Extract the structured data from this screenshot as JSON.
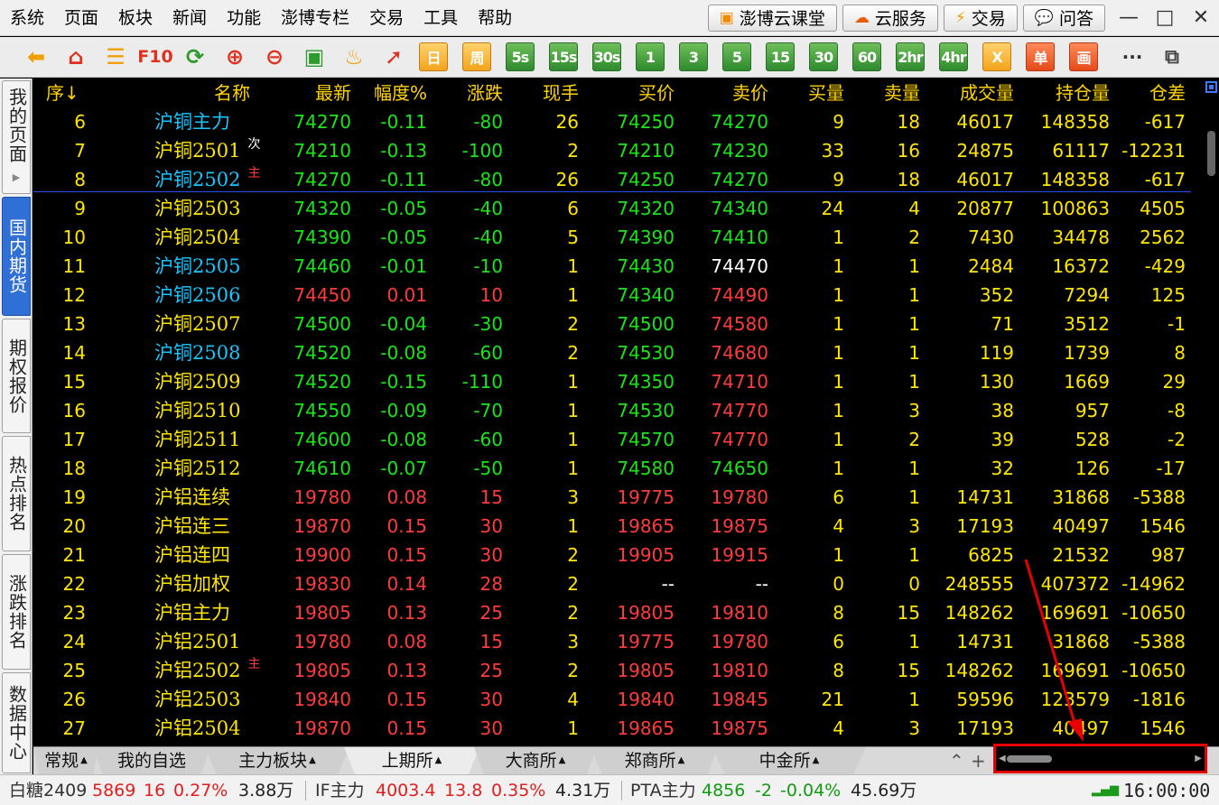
{
  "menu": [
    "系统",
    "页面",
    "板块",
    "新闻",
    "功能",
    "澎博专栏",
    "交易",
    "工具",
    "帮助"
  ],
  "top_buttons": [
    {
      "label": "澎博云课堂",
      "icon": "classroom-icon"
    },
    {
      "label": "云服务",
      "icon": "cloud-icon"
    },
    {
      "label": "交易",
      "icon": "lightning-icon"
    },
    {
      "label": "问答",
      "icon": "chat-icon"
    }
  ],
  "toolbar": {
    "f10": "F10",
    "periods": [
      "日",
      "周",
      "5s",
      "15s",
      "30s",
      "1",
      "3",
      "5",
      "15",
      "30",
      "60",
      "2hr",
      "4hr",
      "X",
      "单",
      "画"
    ],
    "more": "···"
  },
  "sidebar": [
    {
      "label": "我的页面",
      "active": false,
      "arrow": true
    },
    {
      "label": "国内期货",
      "active": true,
      "arrow": false
    },
    {
      "label": "期权报价",
      "active": false,
      "arrow": false
    },
    {
      "label": "热点排名",
      "active": false,
      "arrow": false
    },
    {
      "label": "涨跌排名",
      "active": false,
      "arrow": false
    },
    {
      "label": "数据中心",
      "active": false,
      "arrow": false
    }
  ],
  "columns": [
    "序↓",
    "名称",
    "最新",
    "幅度%",
    "涨跌",
    "现手",
    "买价",
    "卖价",
    "买量",
    "卖量",
    "成交量",
    "持仓量",
    "仓差"
  ],
  "rows": [
    {
      "seq": "6",
      "name": "沪铜主力",
      "tag": "",
      "last": "74270",
      "pct": "-0.11",
      "chg": "-80",
      "hand": "26",
      "bid": "74250",
      "ask": "74270",
      "bidv": "9",
      "askv": "18",
      "vol": "46017",
      "oi": "148358",
      "diff": "-617",
      "nc": "cyan",
      "pc": "green",
      "bc": "green",
      "ac": "green"
    },
    {
      "seq": "7",
      "name": "沪铜2501",
      "tag": "次",
      "last": "74210",
      "pct": "-0.13",
      "chg": "-100",
      "hand": "2",
      "bid": "74210",
      "ask": "74230",
      "bidv": "33",
      "askv": "16",
      "vol": "24875",
      "oi": "61117",
      "diff": "-12231",
      "nc": "yellow",
      "pc": "green",
      "bc": "green",
      "ac": "green"
    },
    {
      "seq": "8",
      "name": "沪铜2502",
      "tag": "主",
      "last": "74270",
      "pct": "-0.11",
      "chg": "-80",
      "hand": "26",
      "bid": "74250",
      "ask": "74270",
      "bidv": "9",
      "askv": "18",
      "vol": "46017",
      "oi": "148358",
      "diff": "-617",
      "nc": "cyan",
      "pc": "green",
      "bc": "green",
      "ac": "green"
    },
    {
      "seq": "9",
      "name": "沪铜2503",
      "tag": "",
      "last": "74320",
      "pct": "-0.05",
      "chg": "-40",
      "hand": "6",
      "bid": "74320",
      "ask": "74340",
      "bidv": "24",
      "askv": "4",
      "vol": "20877",
      "oi": "100863",
      "diff": "4505",
      "nc": "yellow",
      "pc": "green",
      "bc": "green",
      "ac": "green"
    },
    {
      "seq": "10",
      "name": "沪铜2504",
      "tag": "",
      "last": "74390",
      "pct": "-0.05",
      "chg": "-40",
      "hand": "5",
      "bid": "74390",
      "ask": "74410",
      "bidv": "1",
      "askv": "2",
      "vol": "7430",
      "oi": "34478",
      "diff": "2562",
      "nc": "yellow",
      "pc": "green",
      "bc": "green",
      "ac": "green"
    },
    {
      "seq": "11",
      "name": "沪铜2505",
      "tag": "",
      "last": "74460",
      "pct": "-0.01",
      "chg": "-10",
      "hand": "1",
      "bid": "74430",
      "ask": "74470",
      "bidv": "1",
      "askv": "1",
      "vol": "2484",
      "oi": "16372",
      "diff": "-429",
      "nc": "cyan",
      "pc": "green",
      "bc": "green",
      "ac": "white"
    },
    {
      "seq": "12",
      "name": "沪铜2506",
      "tag": "",
      "last": "74450",
      "pct": "0.01",
      "chg": "10",
      "hand": "1",
      "bid": "74340",
      "ask": "74490",
      "bidv": "1",
      "askv": "1",
      "vol": "352",
      "oi": "7294",
      "diff": "125",
      "nc": "cyan",
      "pc": "red",
      "bc": "green",
      "ac": "red"
    },
    {
      "seq": "13",
      "name": "沪铜2507",
      "tag": "",
      "last": "74500",
      "pct": "-0.04",
      "chg": "-30",
      "hand": "2",
      "bid": "74500",
      "ask": "74580",
      "bidv": "1",
      "askv": "1",
      "vol": "71",
      "oi": "3512",
      "diff": "-1",
      "nc": "yellow",
      "pc": "green",
      "bc": "green",
      "ac": "red"
    },
    {
      "seq": "14",
      "name": "沪铜2508",
      "tag": "",
      "last": "74520",
      "pct": "-0.08",
      "chg": "-60",
      "hand": "2",
      "bid": "74530",
      "ask": "74680",
      "bidv": "1",
      "askv": "1",
      "vol": "119",
      "oi": "1739",
      "diff": "8",
      "nc": "cyan",
      "pc": "green",
      "bc": "green",
      "ac": "red"
    },
    {
      "seq": "15",
      "name": "沪铜2509",
      "tag": "",
      "last": "74520",
      "pct": "-0.15",
      "chg": "-110",
      "hand": "1",
      "bid": "74350",
      "ask": "74710",
      "bidv": "1",
      "askv": "1",
      "vol": "130",
      "oi": "1669",
      "diff": "29",
      "nc": "yellow",
      "pc": "green",
      "bc": "green",
      "ac": "red"
    },
    {
      "seq": "16",
      "name": "沪铜2510",
      "tag": "",
      "last": "74550",
      "pct": "-0.09",
      "chg": "-70",
      "hand": "1",
      "bid": "74530",
      "ask": "74770",
      "bidv": "1",
      "askv": "3",
      "vol": "38",
      "oi": "957",
      "diff": "-8",
      "nc": "yellow",
      "pc": "green",
      "bc": "green",
      "ac": "red"
    },
    {
      "seq": "17",
      "name": "沪铜2511",
      "tag": "",
      "last": "74600",
      "pct": "-0.08",
      "chg": "-60",
      "hand": "1",
      "bid": "74570",
      "ask": "74770",
      "bidv": "1",
      "askv": "2",
      "vol": "39",
      "oi": "528",
      "diff": "-2",
      "nc": "yellow",
      "pc": "green",
      "bc": "green",
      "ac": "red"
    },
    {
      "seq": "18",
      "name": "沪铜2512",
      "tag": "",
      "last": "74610",
      "pct": "-0.07",
      "chg": "-50",
      "hand": "1",
      "bid": "74580",
      "ask": "74650",
      "bidv": "1",
      "askv": "1",
      "vol": "32",
      "oi": "126",
      "diff": "-17",
      "nc": "yellow",
      "pc": "green",
      "bc": "green",
      "ac": "green"
    },
    {
      "seq": "19",
      "name": "沪铝连续",
      "tag": "",
      "last": "19780",
      "pct": "0.08",
      "chg": "15",
      "hand": "3",
      "bid": "19775",
      "ask": "19780",
      "bidv": "6",
      "askv": "1",
      "vol": "14731",
      "oi": "31868",
      "diff": "-5388",
      "nc": "yellow",
      "pc": "red",
      "bc": "red",
      "ac": "red"
    },
    {
      "seq": "20",
      "name": "沪铝连三",
      "tag": "",
      "last": "19870",
      "pct": "0.15",
      "chg": "30",
      "hand": "1",
      "bid": "19865",
      "ask": "19875",
      "bidv": "4",
      "askv": "3",
      "vol": "17193",
      "oi": "40497",
      "diff": "1546",
      "nc": "yellow",
      "pc": "red",
      "bc": "red",
      "ac": "red"
    },
    {
      "seq": "21",
      "name": "沪铝连四",
      "tag": "",
      "last": "19900",
      "pct": "0.15",
      "chg": "30",
      "hand": "2",
      "bid": "19905",
      "ask": "19915",
      "bidv": "1",
      "askv": "1",
      "vol": "6825",
      "oi": "21532",
      "diff": "987",
      "nc": "yellow",
      "pc": "red",
      "bc": "red",
      "ac": "red"
    },
    {
      "seq": "22",
      "name": "沪铝加权",
      "tag": "",
      "last": "19830",
      "pct": "0.14",
      "chg": "28",
      "hand": "2",
      "bid": "--",
      "ask": "--",
      "bidv": "0",
      "askv": "0",
      "vol": "248555",
      "oi": "407372",
      "diff": "-14962",
      "nc": "yellow",
      "pc": "red",
      "bc": "white",
      "ac": "white"
    },
    {
      "seq": "23",
      "name": "沪铝主力",
      "tag": "",
      "last": "19805",
      "pct": "0.13",
      "chg": "25",
      "hand": "2",
      "bid": "19805",
      "ask": "19810",
      "bidv": "8",
      "askv": "15",
      "vol": "148262",
      "oi": "169691",
      "diff": "-10650",
      "nc": "yellow",
      "pc": "red",
      "bc": "red",
      "ac": "red"
    },
    {
      "seq": "24",
      "name": "沪铝2501",
      "tag": "",
      "last": "19780",
      "pct": "0.08",
      "chg": "15",
      "hand": "3",
      "bid": "19775",
      "ask": "19780",
      "bidv": "6",
      "askv": "1",
      "vol": "14731",
      "oi": "31868",
      "diff": "-5388",
      "nc": "yellow",
      "pc": "red",
      "bc": "red",
      "ac": "red"
    },
    {
      "seq": "25",
      "name": "沪铝2502",
      "tag": "主",
      "last": "19805",
      "pct": "0.13",
      "chg": "25",
      "hand": "2",
      "bid": "19805",
      "ask": "19810",
      "bidv": "8",
      "askv": "15",
      "vol": "148262",
      "oi": "169691",
      "diff": "-10650",
      "nc": "yellow",
      "pc": "red",
      "bc": "red",
      "ac": "red"
    },
    {
      "seq": "26",
      "name": "沪铝2503",
      "tag": "",
      "last": "19840",
      "pct": "0.15",
      "chg": "30",
      "hand": "4",
      "bid": "19840",
      "ask": "19845",
      "bidv": "21",
      "askv": "1",
      "vol": "59596",
      "oi": "123579",
      "diff": "-1816",
      "nc": "yellow",
      "pc": "red",
      "bc": "red",
      "ac": "red"
    },
    {
      "seq": "27",
      "name": "沪铝2504",
      "tag": "",
      "last": "19870",
      "pct": "0.15",
      "chg": "30",
      "hand": "1",
      "bid": "19865",
      "ask": "19875",
      "bidv": "4",
      "askv": "3",
      "vol": "17193",
      "oi": "40497",
      "diff": "1546",
      "nc": "yellow",
      "pc": "red",
      "bc": "red",
      "ac": "red"
    }
  ],
  "bottom_tabs": [
    {
      "label": "常规",
      "caret": true,
      "active": false
    },
    {
      "label": "我的自选",
      "caret": false,
      "active": false
    },
    {
      "label": "主力板块",
      "caret": true,
      "active": false
    },
    {
      "label": "上期所",
      "caret": true,
      "active": true
    },
    {
      "label": "大商所",
      "caret": true,
      "active": false
    },
    {
      "label": "郑商所",
      "caret": true,
      "active": false
    },
    {
      "label": "中金所",
      "caret": true,
      "active": false
    }
  ],
  "tab_controls": {
    "collapse": "⌃",
    "add": "+"
  },
  "status": {
    "items": [
      {
        "name": "白糖2409",
        "price": "5869",
        "chg": "16",
        "pct": "0.27%",
        "vol": "3.88万",
        "dir": "up"
      },
      {
        "name": "IF主力",
        "price": "4003.4",
        "chg": "13.8",
        "pct": "0.35%",
        "vol": "4.31万",
        "dir": "up"
      },
      {
        "name": "PTA主力",
        "price": "4856",
        "chg": "-2",
        "pct": "-0.04%",
        "vol": "45.69万",
        "dir": "down"
      }
    ],
    "time": "16:00:00"
  },
  "colors": {
    "up": "#ff3b3b",
    "down": "#19e619",
    "accent_blue": "#2f6fd6",
    "highlight": "#e60000"
  }
}
